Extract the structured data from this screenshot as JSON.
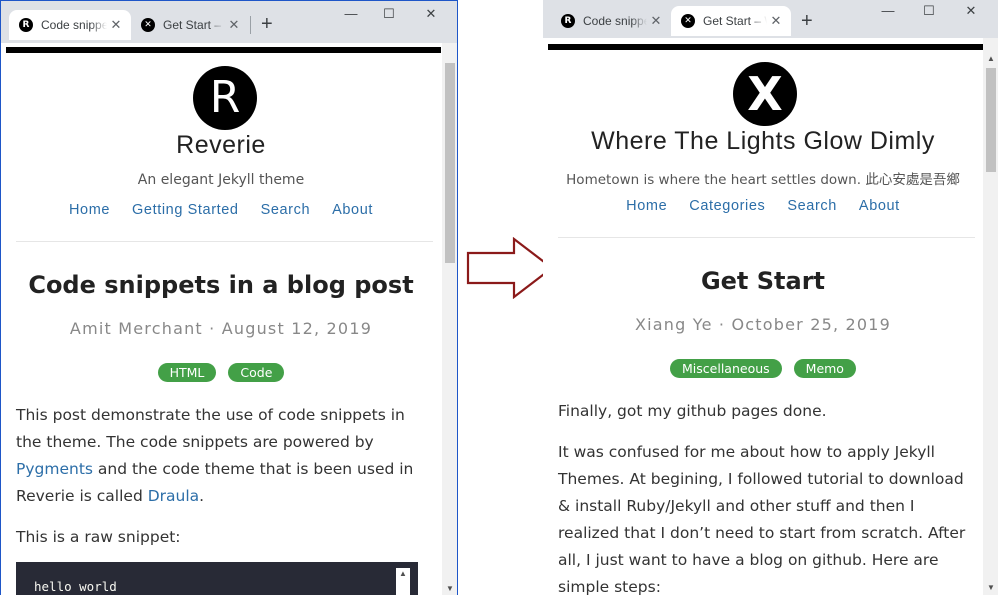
{
  "left_window": {
    "tabs": [
      {
        "favicon": "R",
        "title": "Code snippets in a blog post",
        "active": true
      },
      {
        "favicon": "✕",
        "title": "Get Start – Where The Lights Glow Dimly",
        "active": false
      }
    ],
    "new_tab": "+",
    "controls": {
      "minimize": "—",
      "maximize": "☐",
      "close": "✕"
    },
    "page": {
      "logo_letter": "R",
      "site_title": "Reverie",
      "site_description": "An elegant Jekyll theme",
      "nav": [
        "Home",
        "Getting Started",
        "Search",
        "About"
      ],
      "post_title": "Code snippets in a blog post",
      "post_meta": "Amit Merchant · August 12, 2019",
      "tags": [
        "HTML",
        "Code"
      ],
      "para1_text_a": "This post demonstrate the use of code snippets in the theme. The code snippets are powered by ",
      "para1_link_a": "Pygments",
      "para1_text_b": " and the code theme that is been used in Reverie is called ",
      "para1_link_b": "Draula",
      "para1_text_c": ".",
      "para2": "This is a raw snippet:",
      "code": "hello world"
    }
  },
  "right_window": {
    "tabs": [
      {
        "favicon": "R",
        "title": "Code snippets in a blog post",
        "active": false
      },
      {
        "favicon": "✕",
        "title": "Get Start – Where The Lights Glow Dimly",
        "active": true
      }
    ],
    "new_tab": "+",
    "controls": {
      "minimize": "—",
      "maximize": "☐",
      "close": "✕"
    },
    "page": {
      "logo_letter": "X",
      "site_title": "Where The Lights Glow Dimly",
      "site_description": "Hometown is where the heart settles down. 此心安處是吾鄉",
      "nav": [
        "Home",
        "Categories",
        "Search",
        "About"
      ],
      "post_title": "Get Start",
      "post_meta": "Xiang Ye · October 25, 2019",
      "tags": [
        "Miscellaneous",
        "Memo"
      ],
      "para1": "Finally, got my github pages done.",
      "para2": "It was confused for me about how to apply Jekyll Themes. At begining, I followed tutorial to download & install Ruby/Jekyll and other stuff and then I realized that I don’t need to start from scratch. After all, I just want to have a blog on github. Here are simple steps:"
    }
  },
  "colors": {
    "arrow": "#8b1a1a",
    "tag": "#43a047",
    "link": "#2c6ea8",
    "window_border": "#1e56c8"
  },
  "icons": {
    "arrow": "right-arrow-icon"
  }
}
